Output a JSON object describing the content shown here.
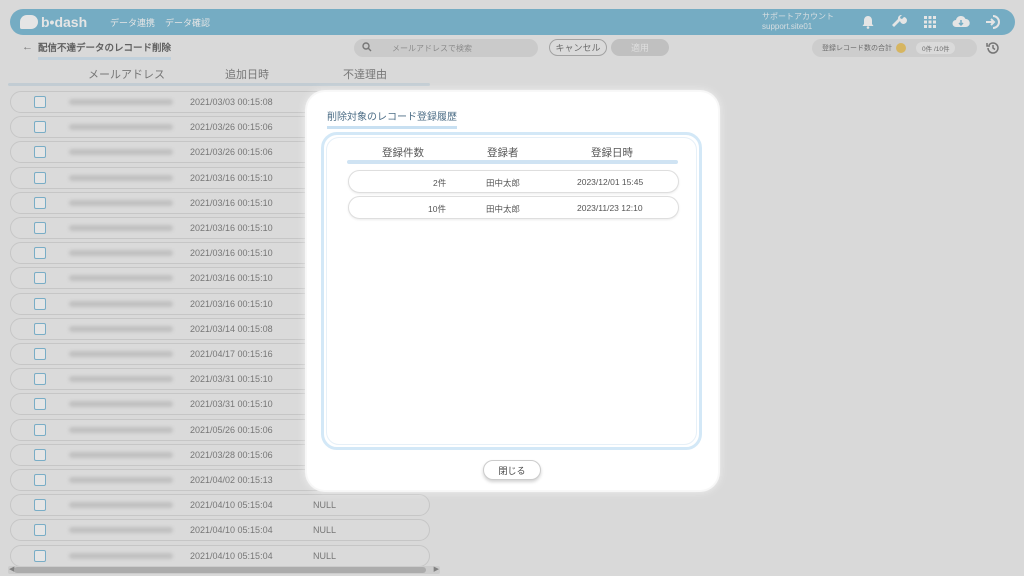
{
  "header": {
    "logo": "b•dash",
    "nav": [
      "データ連携",
      "データ確認"
    ],
    "account_name": "サポートアカウント",
    "account_id": "support.site01",
    "icons": [
      "bell-icon",
      "wrench-icon",
      "grid-icon",
      "cloud-icon",
      "logout-icon"
    ]
  },
  "toolbar": {
    "back": "←",
    "title": "配信不達データのレコード削除",
    "search_placeholder": "メールアドレスで検索",
    "cancel_label": "キャンセル",
    "apply_label": "適用",
    "count_label": "登録レコード数の合計",
    "count_current": "0件",
    "count_total": "/10件"
  },
  "table": {
    "columns": [
      "メールアドレス",
      "追加日時",
      "不達理由"
    ],
    "rows": [
      {
        "date": "2021/03/03 00:15:08",
        "reason": ""
      },
      {
        "date": "2021/03/26 00:15:06",
        "reason": ""
      },
      {
        "date": "2021/03/26 00:15:06",
        "reason": ""
      },
      {
        "date": "2021/03/16 00:15:10",
        "reason": ""
      },
      {
        "date": "2021/03/16 00:15:10",
        "reason": ""
      },
      {
        "date": "2021/03/16 00:15:10",
        "reason": ""
      },
      {
        "date": "2021/03/16 00:15:10",
        "reason": ""
      },
      {
        "date": "2021/03/16 00:15:10",
        "reason": ""
      },
      {
        "date": "2021/03/16 00:15:10",
        "reason": ""
      },
      {
        "date": "2021/03/14 00:15:08",
        "reason": ""
      },
      {
        "date": "2021/04/17 00:15:16",
        "reason": ""
      },
      {
        "date": "2021/03/31 00:15:10",
        "reason": ""
      },
      {
        "date": "2021/03/31 00:15:10",
        "reason": ""
      },
      {
        "date": "2021/05/26 00:15:06",
        "reason": ""
      },
      {
        "date": "2021/03/28 00:15:06",
        "reason": ""
      },
      {
        "date": "2021/04/02 00:15:13",
        "reason": ""
      },
      {
        "date": "2021/04/10 05:15:04",
        "reason": "NULL"
      },
      {
        "date": "2021/04/10 05:15:04",
        "reason": "NULL"
      },
      {
        "date": "2021/04/10 05:15:04",
        "reason": "NULL"
      }
    ]
  },
  "modal": {
    "title": "削除対象のレコード登録履歴",
    "columns": [
      "登録件数",
      "登録者",
      "登録日時"
    ],
    "rows": [
      {
        "count": "2件",
        "user": "田中太郎",
        "datetime": "2023/12/01 15:45"
      },
      {
        "count": "10件",
        "user": "田中太郎",
        "datetime": "2023/11/23 12:10"
      }
    ],
    "close_label": "閉じる"
  },
  "colors": {
    "header": "#54a8cb",
    "accent_light": "#d3e8f7",
    "checkbox": "#5aa9cf"
  }
}
